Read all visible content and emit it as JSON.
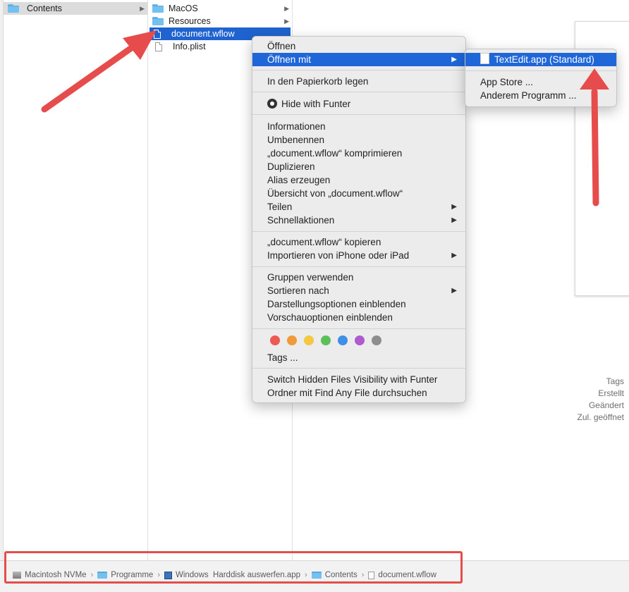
{
  "columns": {
    "col1": [
      {
        "label": "Contents",
        "type": "folder",
        "has_children": true,
        "selected": "inactive"
      }
    ],
    "col2": [
      {
        "label": "MacOS",
        "type": "folder",
        "has_children": true
      },
      {
        "label": "Resources",
        "type": "folder",
        "has_children": true
      },
      {
        "label": "document.wflow",
        "type": "document",
        "selected": "active"
      },
      {
        "label": "Info.plist",
        "type": "document"
      }
    ]
  },
  "context_menu": {
    "open": "Öffnen",
    "open_with": "Öffnen mit",
    "trash": "In den Papierkorb legen",
    "hide_funter": "Hide with Funter",
    "info": "Informationen",
    "rename": "Umbenennen",
    "compress": "„document.wflow“ komprimieren",
    "duplicate": "Duplizieren",
    "alias": "Alias erzeugen",
    "overview": "Übersicht von „document.wflow“",
    "share": "Teilen",
    "quick_actions": "Schnellaktionen",
    "copy": "„document.wflow“ kopieren",
    "import_iphone": "Importieren von iPhone oder iPad",
    "use_groups": "Gruppen verwenden",
    "sort_by": "Sortieren nach",
    "show_view_options": "Darstellungsoptionen einblenden",
    "show_preview_options": "Vorschauoptionen einblenden",
    "tag_colors": [
      "#ec5a53",
      "#f09a3a",
      "#f5c842",
      "#5ac05a",
      "#3e8fe8",
      "#b05ad0",
      "#8e8e8e"
    ],
    "tags": "Tags ...",
    "switch_hidden": "Switch Hidden Files Visibility with Funter",
    "find_any_file": "Ordner mit Find Any File durchsuchen"
  },
  "submenu": {
    "textedit": "TextEdit.app (Standard)",
    "app_store": "App Store ...",
    "other": "Anderem Programm ..."
  },
  "preview_meta": [
    "Tags",
    "Erstellt",
    "Geändert",
    "Zul. geöffnet"
  ],
  "pathbar": [
    {
      "label": "Macintosh NVMe",
      "icon": "hard-disk-icon"
    },
    {
      "label": "Programme",
      "icon": "folder-icon"
    },
    {
      "label": "Windows  Harddisk auswerfen.app",
      "icon": "app-icon"
    },
    {
      "label": "Contents",
      "icon": "folder-icon"
    },
    {
      "label": "document.wflow",
      "icon": "document-icon"
    }
  ],
  "colors": {
    "selection_blue": "#1f66d9",
    "annotation_red": "#e74c4c",
    "folder_blue": "#74c0ee"
  }
}
